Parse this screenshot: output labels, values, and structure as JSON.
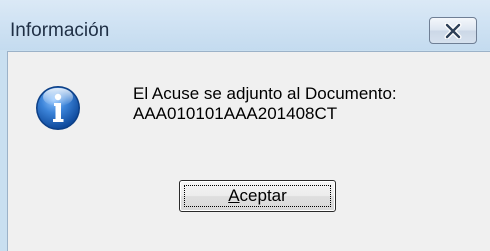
{
  "window": {
    "title": "Información"
  },
  "message": {
    "line1": "El Acuse se adjunto al Documento:",
    "line2": "AAA010101AAA201408CT"
  },
  "buttons": {
    "accept_mnemonic": "A",
    "accept_rest": "ceptar"
  },
  "icons": {
    "close": "close-icon",
    "info": "information-icon"
  },
  "colors": {
    "title_bar": "#cfe2f3",
    "content_bg": "#f0f0f0",
    "info_icon_blue": "#1d5fb4"
  }
}
